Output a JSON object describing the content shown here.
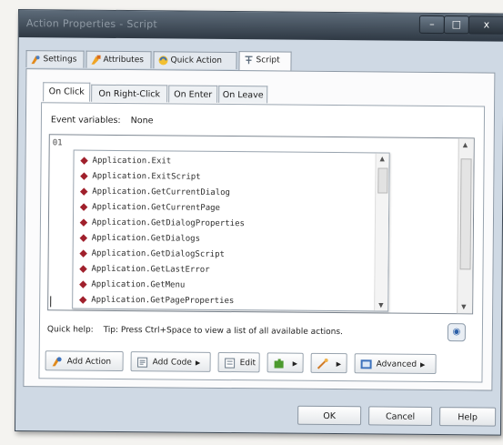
{
  "window": {
    "title": "Action Properties - Script",
    "controls": {
      "minimize": "–",
      "maximize": "□",
      "close": "x"
    }
  },
  "main_tabs": [
    {
      "label": "Settings",
      "icon": "settings-icon"
    },
    {
      "label": "Attributes",
      "icon": "attributes-icon"
    },
    {
      "label": "Quick Action",
      "icon": "quick-action-icon"
    },
    {
      "label": "Script",
      "icon": "script-icon",
      "active": true
    }
  ],
  "sub_tabs": [
    {
      "label": "On Click",
      "active": true
    },
    {
      "label": "On Right-Click"
    },
    {
      "label": "On Enter"
    },
    {
      "label": "On Leave"
    }
  ],
  "event_variables": {
    "label": "Event variables:",
    "value": "None"
  },
  "editor": {
    "line_number": "01",
    "autocomplete": [
      "Application.Exit",
      "Application.ExitScript",
      "Application.GetCurrentDialog",
      "Application.GetCurrentPage",
      "Application.GetDialogProperties",
      "Application.GetDialogs",
      "Application.GetDialogScript",
      "Application.GetLastError",
      "Application.GetMenu",
      "Application.GetPageProperties"
    ]
  },
  "quick_help": {
    "label": "Quick help:",
    "text": "Tip: Press Ctrl+Space to view a list of all available actions."
  },
  "toolbar": {
    "add_action": "Add Action",
    "add_code": "Add Code",
    "edit": "Edit",
    "advanced": "Advanced",
    "dropdown_arrow": "▶"
  },
  "footer": {
    "ok": "OK",
    "cancel": "Cancel",
    "help": "Help"
  },
  "colors": {
    "titlebar": "#3a4550",
    "bullet": "#a0202c",
    "frame": "#cfd9e4"
  }
}
